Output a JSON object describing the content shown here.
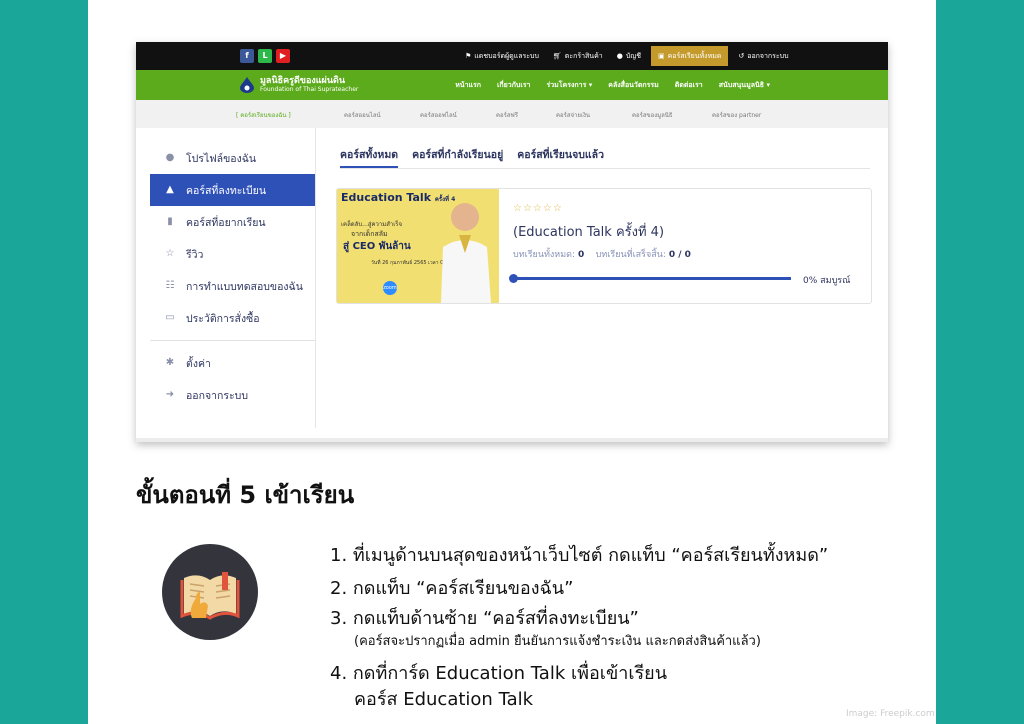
{
  "top_bar": {
    "social": [
      {
        "name": "facebook-icon",
        "glyph": "f",
        "color": "#3b5998"
      },
      {
        "name": "line-icon",
        "glyph": "L",
        "color": "#2fb84a"
      },
      {
        "name": "youtube-icon",
        "glyph": "▶",
        "color": "#e02020"
      }
    ],
    "items": [
      "แดชบอร์ดผู้ดูแลระบบ",
      "ตะกร้าสินค้า",
      "บัญชี",
      "คอร์สเรียนทั้งหมด",
      "ออกจากระบบ"
    ]
  },
  "brand": {
    "name_th": "มูลนิธิครูดีของแผ่นดิน",
    "name_en": "Foundation of Thai Suprateacher"
  },
  "main_nav": [
    "หน้าแรก",
    "เกี่ยวกับเรา",
    "ร่วมโครงการ ▾",
    "คลังสื่อนวัตกรรม",
    "ติดต่อเรา",
    "สนับสนุนมูลนิธิ ▾"
  ],
  "sub_nav": [
    "[ คอร์สเรียนของฉัน ]",
    "คอร์สออนไลน์",
    "คอร์สออฟไลน์",
    "คอร์สฟรี",
    "คอร์สจ่ายเงิน",
    "คอร์สของมูลนิธิ",
    "คอร์สของ partner"
  ],
  "sidebar": {
    "items": [
      {
        "label": "โปรไฟล์ของฉัน",
        "icon": "user-icon"
      },
      {
        "label": "คอร์สที่ลงทะเบียน",
        "icon": "graduation-cap-icon"
      },
      {
        "label": "คอร์สที่อยากเรียน",
        "icon": "bookmark-icon"
      },
      {
        "label": "รีวิว",
        "icon": "star-icon"
      },
      {
        "label": "การทำแบบทดสอบของฉัน",
        "icon": "quiz-icon"
      },
      {
        "label": "ประวัติการสั่งซื้อ",
        "icon": "cart-icon"
      },
      {
        "label": "ตั้งค่า",
        "icon": "gear-icon"
      },
      {
        "label": "ออกจากระบบ",
        "icon": "logout-icon"
      }
    ]
  },
  "tabs": [
    "คอร์สทั้งหมด",
    "คอร์สที่กำลังเรียนอยู่",
    "คอร์สที่เรียนจบแล้ว"
  ],
  "course_card": {
    "thumb_title": "Education Talk",
    "thumb_ep": "ครั้งที่ 4",
    "thumb_line1": "เคล็ดลับ...สู่ความสำเร็จ",
    "thumb_line2": "จากเด็กสลัม",
    "thumb_line3": "สู่ CEO พันล้าน",
    "thumb_date": "วันที่ 26 กุมภาพันธ์ 2565 เวลา 09.00-12.00 น.",
    "thumb_zoom": "zoom",
    "stars": "☆☆☆☆☆",
    "title": "(Education Talk ครั้งที่ 4)",
    "total_label": "บทเรียนทั้งหมด:",
    "total_value": "0",
    "done_label": "บทเรียนที่เสร็จสิ้น:",
    "done_value": "0 / 0",
    "progress_text": "0% สมบูรณ์",
    "progress_fraction": 0
  },
  "heading": "ขั้นตอนที่ 5 เข้าเรียน",
  "steps": [
    "1. ที่เมนูด้านบนสุดของหน้าเว็บไซต์ กดแท็บ “คอร์สเรียนทั้งหมด”",
    "2. กดแท็บ “คอร์สเรียนของฉัน”",
    "3. กดแท็บด้านซ้าย “คอร์สที่ลงทะเบียน”",
    "(คอร์สจะปรากฏเมื่อ admin ยืนยันการแจ้งชำระเงิน และกดส่งสินค้าแล้ว)",
    "4. กดที่การ์ด Education Talk เพื่อเข้าเรียน",
    "คอร์ส Education Talk"
  ],
  "credit": "Image: Freepik.com"
}
